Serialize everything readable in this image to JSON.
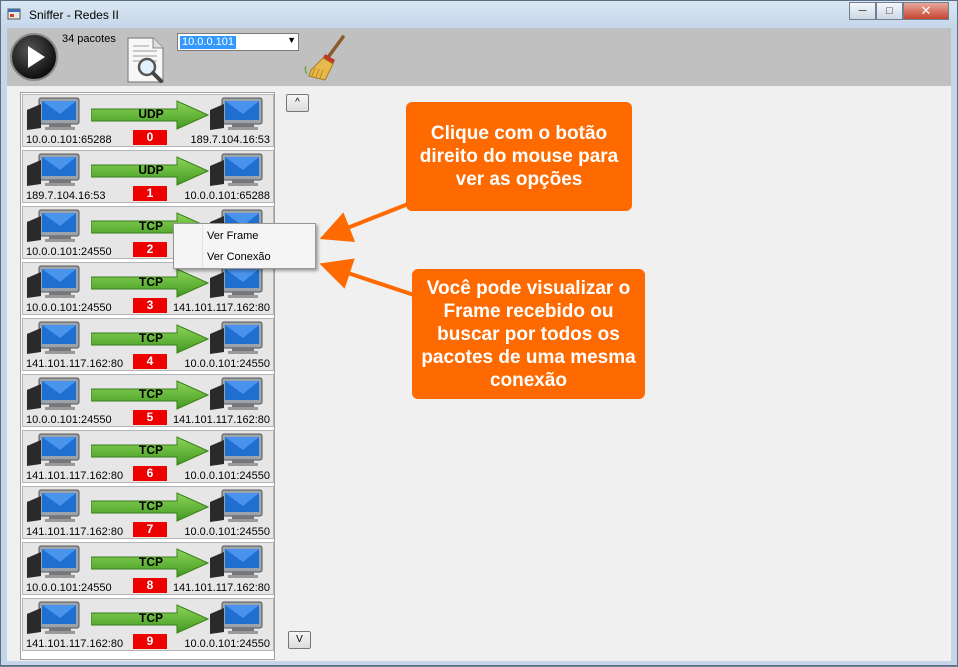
{
  "window": {
    "title": "Sniffer - Redes II",
    "minimize": "─",
    "maximize": "□",
    "close": "✕"
  },
  "toolbar": {
    "packet_count": "34 pacotes",
    "ip_filter_value": "10.0.0.101",
    "play_icon": "play-icon",
    "doc_icon": "document-magnifier-icon",
    "broom_icon": "broom-icon"
  },
  "packets": [
    {
      "protocol": "UDP",
      "index": "0",
      "src": "10.0.0.101:65288",
      "dst": "189.7.104.16:53"
    },
    {
      "protocol": "UDP",
      "index": "1",
      "src": "189.7.104.16:53",
      "dst": "10.0.0.101:65288"
    },
    {
      "protocol": "TCP",
      "index": "2",
      "src": "10.0.0.101:24550",
      "dst": ""
    },
    {
      "protocol": "TCP",
      "index": "3",
      "src": "10.0.0.101:24550",
      "dst": "141.101.117.162:80"
    },
    {
      "protocol": "TCP",
      "index": "4",
      "src": "141.101.117.162:80",
      "dst": "10.0.0.101:24550"
    },
    {
      "protocol": "TCP",
      "index": "5",
      "src": "10.0.0.101:24550",
      "dst": "141.101.117.162:80"
    },
    {
      "protocol": "TCP",
      "index": "6",
      "src": "141.101.117.162:80",
      "dst": "10.0.0.101:24550"
    },
    {
      "protocol": "TCP",
      "index": "7",
      "src": "141.101.117.162:80",
      "dst": "10.0.0.101:24550"
    },
    {
      "protocol": "TCP",
      "index": "8",
      "src": "10.0.0.101:24550",
      "dst": "141.101.117.162:80"
    },
    {
      "protocol": "TCP",
      "index": "9",
      "src": "141.101.117.162:80",
      "dst": "10.0.0.101:24550"
    }
  ],
  "scroll": {
    "up": "^",
    "down": "V"
  },
  "context_menu": {
    "view_frame": "Ver Frame",
    "view_connection": "Ver Conexão"
  },
  "callouts": {
    "right_click": "Clique com o botão direito do mouse para ver as opções",
    "view_options": "Você pode visualizar o Frame recebido ou buscar por todos os pacotes de uma mesma conexão"
  },
  "colors": {
    "callout": "#ff6a00",
    "index_badge": "#ee0000",
    "arrow": "#5cb82e",
    "toolbar": "#c0c0c0"
  }
}
